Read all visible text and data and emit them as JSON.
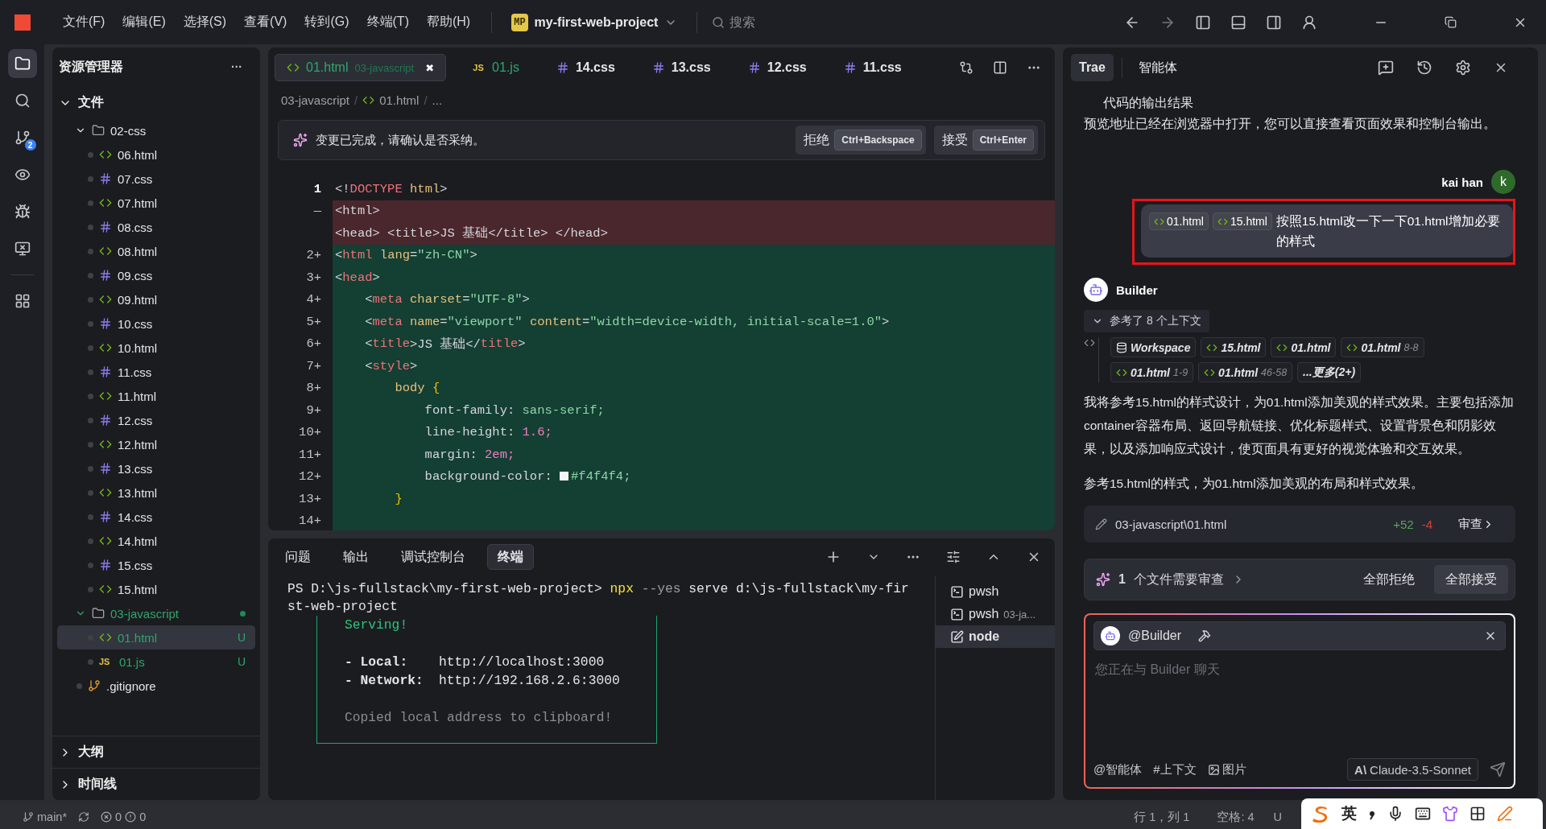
{
  "titlebar": {
    "menus": [
      "文件(F)",
      "编辑(E)",
      "选择(S)",
      "查看(V)",
      "转到(G)",
      "终端(T)",
      "帮助(H)"
    ],
    "project": {
      "badge": "MP",
      "name": "my-first-web-project"
    },
    "search": {
      "placeholder": "搜索"
    }
  },
  "activity_bar": {
    "items": [
      {
        "kind": "files",
        "selected": true
      },
      {
        "kind": "search",
        "selected": false
      },
      {
        "kind": "git",
        "selected": false,
        "badge": "2"
      },
      {
        "kind": "preview",
        "selected": false
      },
      {
        "kind": "debug",
        "selected": false
      },
      {
        "kind": "remote",
        "selected": false
      },
      {
        "kind": "extensions",
        "selected": false
      }
    ]
  },
  "explorer": {
    "title": "资源管理器",
    "more": "···",
    "sections": [
      {
        "label": "文件",
        "expanded": true,
        "children": [
          {
            "name": "02-css",
            "kind": "folder",
            "expanded": true,
            "changed": false,
            "selected": false,
            "children": [
              {
                "name": "06.html",
                "kind": "html",
                "selected": false
              },
              {
                "name": "07.css",
                "kind": "css",
                "selected": false
              },
              {
                "name": "07.html",
                "kind": "html",
                "selected": false
              },
              {
                "name": "08.css",
                "kind": "css",
                "selected": false
              },
              {
                "name": "08.html",
                "kind": "html",
                "selected": false
              },
              {
                "name": "09.css",
                "kind": "css",
                "selected": false
              },
              {
                "name": "09.html",
                "kind": "html",
                "selected": false
              },
              {
                "name": "10.css",
                "kind": "css",
                "selected": false
              },
              {
                "name": "10.html",
                "kind": "html",
                "selected": false
              },
              {
                "name": "11.css",
                "kind": "css",
                "selected": false
              },
              {
                "name": "11.html",
                "kind": "html",
                "selected": false
              },
              {
                "name": "12.css",
                "kind": "css",
                "selected": false
              },
              {
                "name": "12.html",
                "kind": "html",
                "selected": false
              },
              {
                "name": "13.css",
                "kind": "css",
                "selected": false
              },
              {
                "name": "13.html",
                "kind": "html",
                "selected": false
              },
              {
                "name": "14.css",
                "kind": "css",
                "selected": false
              },
              {
                "name": "14.html",
                "kind": "html",
                "selected": false
              },
              {
                "name": "15.css",
                "kind": "css",
                "selected": false
              },
              {
                "name": "15.html",
                "kind": "html",
                "selected": false
              }
            ]
          },
          {
            "name": "03-javascript",
            "kind": "folder",
            "expanded": true,
            "changed": true,
            "selected": false,
            "children": [
              {
                "name": "01.html",
                "kind": "html",
                "status": "U",
                "selected": true
              },
              {
                "name": "01.js",
                "kind": "js",
                "badge": "JS",
                "status": "U",
                "selected": false
              }
            ]
          },
          {
            "name": ".gitignore",
            "kind": "git",
            "selected": false
          }
        ]
      },
      {
        "label": "大纲",
        "expanded": false
      },
      {
        "label": "时间线",
        "expanded": false
      }
    ]
  },
  "editor": {
    "tabs": [
      {
        "label": "01.html",
        "kind": "html",
        "detail": "03-javascript",
        "untracked": true,
        "selected": true,
        "close": "✖"
      },
      {
        "label": "01.js",
        "kind": "js",
        "badge": "JS",
        "untracked": true,
        "selected": false
      },
      {
        "label": "14.css",
        "kind": "css",
        "untracked": false,
        "selected": false
      },
      {
        "label": "13.css",
        "kind": "css",
        "untracked": false,
        "selected": false
      },
      {
        "label": "12.css",
        "kind": "css",
        "untracked": false,
        "selected": false
      },
      {
        "label": "11.css",
        "kind": "css",
        "untracked": false,
        "selected": false
      }
    ],
    "breadcrumb": [
      "03-javascript",
      "01.html",
      "..."
    ],
    "breadcrumb_separator": "/",
    "notice": {
      "text": "变更已完成，请确认是否采纳。",
      "buttons": [
        {
          "label": "拒绝",
          "shortcut": "Ctrl+Backspace"
        },
        {
          "label": "接受",
          "shortcut": "Ctrl+Enter"
        }
      ]
    },
    "lines": [
      {
        "number": "1",
        "added": false,
        "removed": false,
        "segments": [
          {
            "kind": "p",
            "text": "<!"
          },
          {
            "kind": "tag",
            "text": "DOCTYPE"
          },
          {
            "kind": "attr",
            "text": " html"
          },
          {
            "kind": "p",
            "text": ">"
          }
        ]
      },
      {
        "number": "—",
        "added": false,
        "removed": true,
        "segments": [
          {
            "kind": "p",
            "text": "<html>"
          }
        ]
      },
      {
        "added": false,
        "removed": true,
        "segments": [
          {
            "kind": "p",
            "text": "<head> <title>JS 基础</title> </head>"
          }
        ]
      },
      {
        "number": "2+",
        "added": true,
        "removed": false,
        "segments": [
          {
            "kind": "p",
            "text": "<"
          },
          {
            "kind": "tag",
            "text": "html"
          },
          {
            "kind": "attr",
            "text": " lang"
          },
          {
            "kind": "p",
            "text": "="
          },
          {
            "kind": "str",
            "text": "\"zh-CN\""
          },
          {
            "kind": "p",
            "text": ">"
          }
        ]
      },
      {
        "number": "3+",
        "added": true,
        "removed": false,
        "segments": [
          {
            "kind": "p",
            "text": "<"
          },
          {
            "kind": "tag",
            "text": "head"
          },
          {
            "kind": "p",
            "text": ">"
          }
        ]
      },
      {
        "number": "4+",
        "added": true,
        "removed": false,
        "segments": [
          {
            "kind": "p",
            "text": "    <"
          },
          {
            "kind": "tag",
            "text": "meta"
          },
          {
            "kind": "attr",
            "text": " charset"
          },
          {
            "kind": "p",
            "text": "="
          },
          {
            "kind": "str",
            "text": "\"UTF-8\""
          },
          {
            "kind": "p",
            "text": ">"
          }
        ]
      },
      {
        "number": "5+",
        "added": true,
        "removed": false,
        "segments": [
          {
            "kind": "p",
            "text": "    <"
          },
          {
            "kind": "tag",
            "text": "meta"
          },
          {
            "kind": "attr",
            "text": " name"
          },
          {
            "kind": "p",
            "text": "="
          },
          {
            "kind": "str",
            "text": "\"viewport\""
          },
          {
            "kind": "attr",
            "text": " content"
          },
          {
            "kind": "p",
            "text": "="
          },
          {
            "kind": "str",
            "text": "\"width=device-width, initial-scale=1.0\""
          },
          {
            "kind": "p",
            "text": ">"
          }
        ]
      },
      {
        "number": "6+",
        "added": true,
        "removed": false,
        "segments": [
          {
            "kind": "p",
            "text": "    <"
          },
          {
            "kind": "tag",
            "text": "title"
          },
          {
            "kind": "p",
            "text": ">JS 基础</"
          },
          {
            "kind": "tag",
            "text": "title"
          },
          {
            "kind": "p",
            "text": ">"
          }
        ]
      },
      {
        "number": "7+",
        "added": true,
        "removed": false,
        "segments": [
          {
            "kind": "p",
            "text": "    <"
          },
          {
            "kind": "tag",
            "text": "style"
          },
          {
            "kind": "p",
            "text": ">"
          }
        ]
      },
      {
        "number": "8+",
        "added": true,
        "removed": false,
        "segments": [
          {
            "kind": "attr",
            "text": "        body "
          },
          {
            "kind": "brace",
            "text": "{"
          }
        ]
      },
      {
        "number": "9+",
        "added": true,
        "removed": false,
        "segments": [
          {
            "kind": "p",
            "text": "            font-family: "
          },
          {
            "kind": "str",
            "text": "sans-serif;"
          }
        ]
      },
      {
        "number": "10+",
        "added": true,
        "removed": false,
        "segments": [
          {
            "kind": "p",
            "text": "            line-height: "
          },
          {
            "kind": "num",
            "text": "1.6;"
          }
        ]
      },
      {
        "number": "11+",
        "added": true,
        "removed": false,
        "segments": [
          {
            "kind": "p",
            "text": "            margin: "
          },
          {
            "kind": "num",
            "text": "2em;"
          }
        ]
      },
      {
        "number": "12+",
        "added": true,
        "removed": false,
        "segments": [
          {
            "kind": "p",
            "text": "            background-color: "
          },
          {
            "kind": "color",
            "text": "#f4f4f4;",
            "color": "#f4f4f4"
          }
        ]
      },
      {
        "number": "13+",
        "added": true,
        "removed": false,
        "segments": [
          {
            "kind": "brace",
            "text": "        }"
          }
        ]
      },
      {
        "number": "14+",
        "added": true,
        "removed": false
      }
    ]
  },
  "panel": {
    "tabs": [
      {
        "label": "问题",
        "selected": false
      },
      {
        "label": "输出",
        "selected": false
      },
      {
        "label": "调试控制台",
        "selected": false
      },
      {
        "label": "终端",
        "selected": true
      }
    ],
    "terminal": {
      "command": [
        {
          "kind": "plain",
          "text": "PS D:\\js-fullstack\\my-first-web-project> "
        },
        {
          "kind": "cmd",
          "text": "npx"
        },
        {
          "kind": "flag",
          "text": " --yes"
        },
        {
          "kind": "plain",
          "text": " serve d:\\js-fullstack\\my-fir"
        }
      ],
      "wrap": "st-web-project",
      "box": {
        "status": "Serving!",
        "rows": [
          {
            "label": "- Local:",
            "value": "http://localhost:3000"
          },
          {
            "label": "- Network:",
            "value": "http://192.168.2.6:3000"
          }
        ],
        "note": "Copied local address to clipboard!"
      }
    },
    "sessions": [
      {
        "name": "pwsh",
        "kind": "shell",
        "selected": false
      },
      {
        "name": "pwsh",
        "detail": "03-ja...",
        "kind": "shell",
        "selected": false
      },
      {
        "name": "node",
        "kind": "node",
        "selected": true
      }
    ]
  },
  "chat": {
    "tabs": [
      {
        "label": "Trae",
        "selected": true
      },
      {
        "label": "智能体",
        "selected": false
      }
    ],
    "output_heading": "代码的输出结果",
    "output_text": "预览地址已经在浏览器中打开，您可以直接查看页面效果和控制台输出。",
    "user": {
      "name": "kai han",
      "avatar": "k",
      "chips": [
        "01.html",
        "15.html"
      ],
      "text": "按照15.html改一下一下01.html增加必要的样式",
      "highlighted": true
    },
    "agent": {
      "name": "Builder",
      "context_label": "参考了 8 个上下文",
      "context_expanded": true,
      "contexts": [
        {
          "kind": "workspace",
          "label": "Workspace"
        },
        {
          "kind": "file",
          "label": "15.html"
        },
        {
          "kind": "file",
          "label": "01.html"
        },
        {
          "kind": "file",
          "label": "01.html",
          "range": "8-8"
        },
        {
          "kind": "file",
          "label": "01.html",
          "range": "1-9"
        },
        {
          "kind": "file",
          "label": "01.html",
          "range": "46-58"
        },
        {
          "kind": "more",
          "label": "...更多(2+)"
        }
      ],
      "paragraphs": [
        "我将参考15.html的样式设计，为01.html添加美观的样式效果。主要包括添加container容器布局、返回导航链接、优化标题样式、设置背景色和阴影效果，以及添加响应式设计，使页面具有更好的视觉体验和交互效果。",
        "参考15.html的样式，为01.html添加美观的布局和样式效果。"
      ],
      "file": {
        "path": "03-javascript\\01.html",
        "added": "+52",
        "removed": "-4",
        "action": "审查"
      }
    },
    "review": {
      "count": "1",
      "text": "个文件需要审查",
      "reject": "全部拒绝",
      "accept": "全部接受"
    },
    "input": {
      "agent": "@Builder",
      "placeholder": "您正在与 Builder 聊天",
      "tools": [
        {
          "kind": "agent",
          "label": "@智能体"
        },
        {
          "kind": "context",
          "label": "#上下文"
        },
        {
          "kind": "image",
          "label": "图片"
        }
      ],
      "model_mark": "A\\",
      "model": "Claude-3.5-Sonnet"
    }
  },
  "status_bar": {
    "branch": "main*",
    "errors": "0",
    "warnings": "0",
    "cursor": "行 1，列 1",
    "indent": "空格: 4",
    "encoding": "U"
  },
  "ime": {
    "mode": "英"
  }
}
